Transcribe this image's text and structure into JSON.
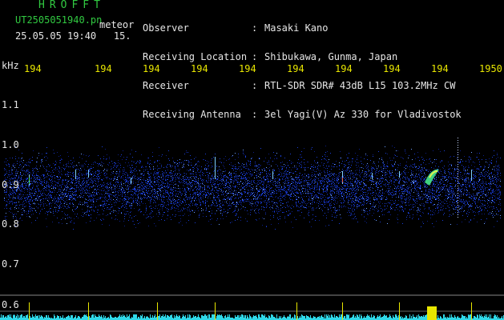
{
  "header": {
    "title": "HROFFT",
    "filename": "UT2505051940.pn",
    "mode": "meteor",
    "datetime": "25.05.05 19:40",
    "interval": "15.",
    "meta": [
      {
        "key": "Observer",
        "value": "Masaki Kano"
      },
      {
        "key": "Receiving Location",
        "value": "Shibukawa, Gunma, Japan"
      },
      {
        "key": "Receiver",
        "value": "RTL-SDR SDR# 43dB L15 103.2MHz CW"
      },
      {
        "key": "Receiving Antenna",
        "value": "3el Yagi(V) Az 330 for Vladivostok"
      }
    ]
  },
  "axis": {
    "y_unit": "kHz",
    "y_ticks": [
      "1.1",
      "1.0",
      "0.9",
      "0.8",
      "0.7",
      "0.6"
    ],
    "x_ticks": [
      "194",
      "194",
      "194",
      "194",
      "194",
      "194",
      "194",
      "194",
      "194",
      "1950"
    ]
  },
  "colors": {
    "background": "#000000",
    "header_green": "#31c941",
    "tick_yellow": "#e8e600",
    "noise_blue": "#1a3fd8",
    "level_cyan": "#2fd8e8"
  }
}
